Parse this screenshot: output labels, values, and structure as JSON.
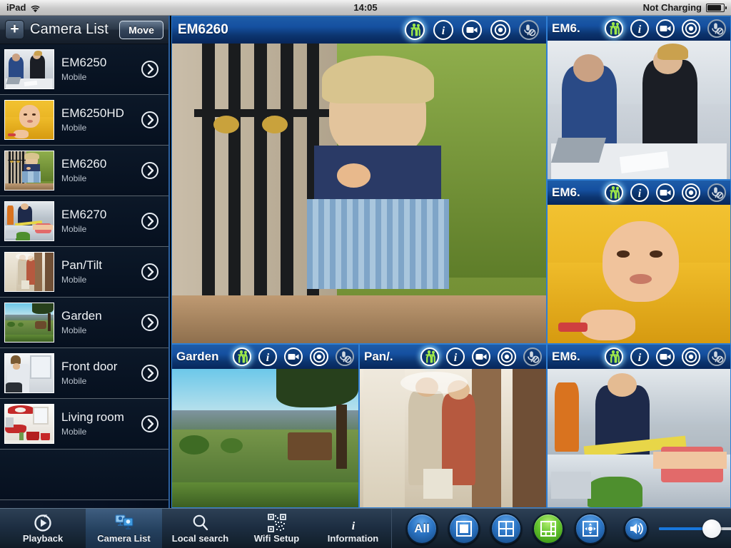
{
  "statusbar": {
    "device": "iPad",
    "wifi_icon": "wifi-icon",
    "time": "14:05",
    "battery_label": "Not Charging",
    "battery_icon": "battery-icon"
  },
  "sidebar": {
    "add_button_label": "+",
    "title": "Camera List",
    "move_button_label": "Move",
    "items": [
      {
        "name": "EM6250",
        "subtitle": "Mobile",
        "thumb": "office",
        "chevron": "chevron-right-icon"
      },
      {
        "name": "EM6250HD",
        "subtitle": "Mobile",
        "thumb": "baby",
        "chevron": "chevron-right-icon"
      },
      {
        "name": "EM6260",
        "subtitle": "Mobile",
        "thumb": "gate",
        "chevron": "chevron-right-icon"
      },
      {
        "name": "EM6270",
        "subtitle": "Mobile",
        "thumb": "market",
        "chevron": "chevron-right-icon"
      },
      {
        "name": "Pan/Tilt",
        "subtitle": "Mobile",
        "thumb": "mall",
        "chevron": "chevron-right-icon"
      },
      {
        "name": "Garden",
        "subtitle": "Mobile",
        "thumb": "garden",
        "chevron": "chevron-right-icon"
      },
      {
        "name": "Front door",
        "subtitle": "Mobile",
        "thumb": "door",
        "chevron": "chevron-right-icon"
      },
      {
        "name": "Living room",
        "subtitle": "Mobile",
        "thumb": "living",
        "chevron": "chevron-right-icon"
      }
    ]
  },
  "grid": {
    "icon_names": [
      "motion-detect-icon",
      "info-icon",
      "video-record-icon",
      "snapshot-icon",
      "microphone-muted-icon"
    ],
    "tiles": [
      {
        "title": "EM6260",
        "scene": "gate",
        "size": "large",
        "mic_muted": true,
        "motion_active": true
      },
      {
        "title": "EM6.",
        "scene": "office",
        "size": "small",
        "mic_muted": true,
        "motion_active": true
      },
      {
        "title": "EM6.",
        "scene": "baby",
        "size": "small",
        "mic_muted": true,
        "motion_active": true
      },
      {
        "title": "Garden",
        "scene": "garden",
        "size": "small",
        "mic_muted": true,
        "motion_active": true
      },
      {
        "title": "Pan/.",
        "scene": "mall",
        "size": "small",
        "mic_muted": true,
        "motion_active": true
      },
      {
        "title": "EM6.",
        "scene": "market",
        "size": "small",
        "mic_muted": true,
        "motion_active": true
      }
    ]
  },
  "toolbar": {
    "tabs": [
      {
        "label": "Playback",
        "icon": "playback-icon",
        "active": false
      },
      {
        "label": "Camera List",
        "icon": "camera-list-icon",
        "active": true
      },
      {
        "label": "Local search",
        "icon": "search-icon",
        "active": false
      },
      {
        "label": "Wifi Setup",
        "icon": "qrcode-icon",
        "active": false
      },
      {
        "label": "Information",
        "icon": "info-icon",
        "active": false
      }
    ],
    "view_buttons": [
      {
        "label": "All",
        "icon": "all-channels-button",
        "selected": false
      },
      {
        "label": "",
        "icon": "layout-1x1-icon",
        "selected": false
      },
      {
        "label": "",
        "icon": "layout-2x2-icon",
        "selected": false
      },
      {
        "label": "",
        "icon": "layout-1plus5-icon",
        "selected": true
      },
      {
        "label": "",
        "icon": "pan-tilt-icon",
        "selected": false
      }
    ],
    "volume": {
      "icon": "speaker-icon",
      "value_percent": 62
    }
  },
  "colors": {
    "accent_blue": "#1877dd",
    "tile_bar_blue": "#1550a0",
    "selected_green": "#62c32e",
    "sidebar_bg": "#06101f"
  }
}
